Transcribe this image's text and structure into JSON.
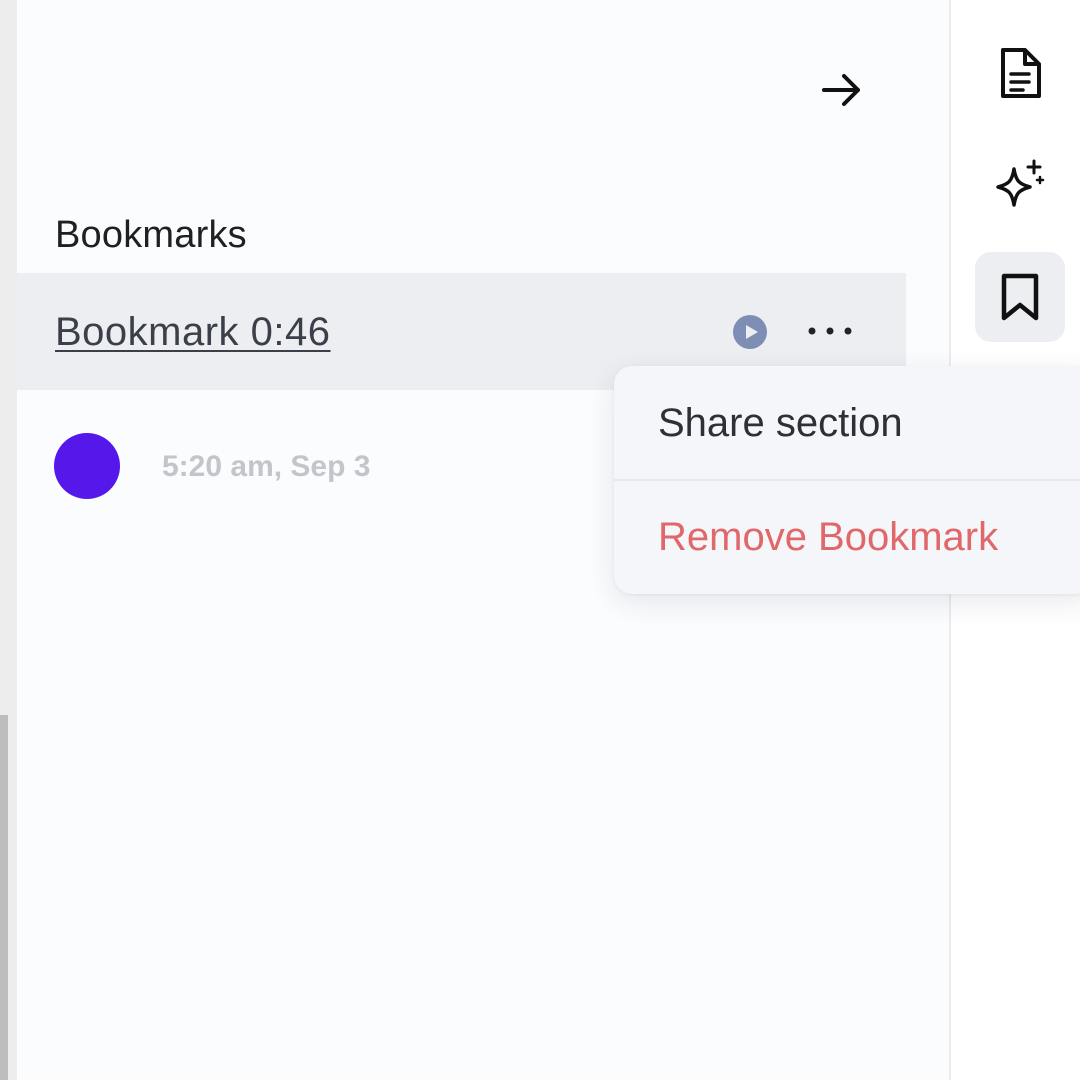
{
  "header": {
    "collapse_icon": "arrow-right-icon"
  },
  "bookmarks": {
    "title": "Bookmarks",
    "items": [
      {
        "label": "Bookmark 0:46",
        "timestamp": "5:20 am, Sep 3",
        "avatar_color": "#5517EA",
        "play_icon": "play-circle-icon",
        "more_icon": "more-horizontal-icon"
      }
    ]
  },
  "context_menu": {
    "items": [
      {
        "label": "Share section",
        "color": "#2E3038"
      },
      {
        "label": "Remove Bookmark",
        "color": "#E0676A"
      }
    ]
  },
  "sidebar": {
    "items": [
      {
        "icon": "document-icon",
        "active": false
      },
      {
        "icon": "sparkles-icon",
        "active": false
      },
      {
        "icon": "bookmark-icon",
        "active": true
      }
    ]
  },
  "colors": {
    "accent": "#5517EA",
    "danger": "#E0676A",
    "play_icon": "#7D8DB3"
  }
}
